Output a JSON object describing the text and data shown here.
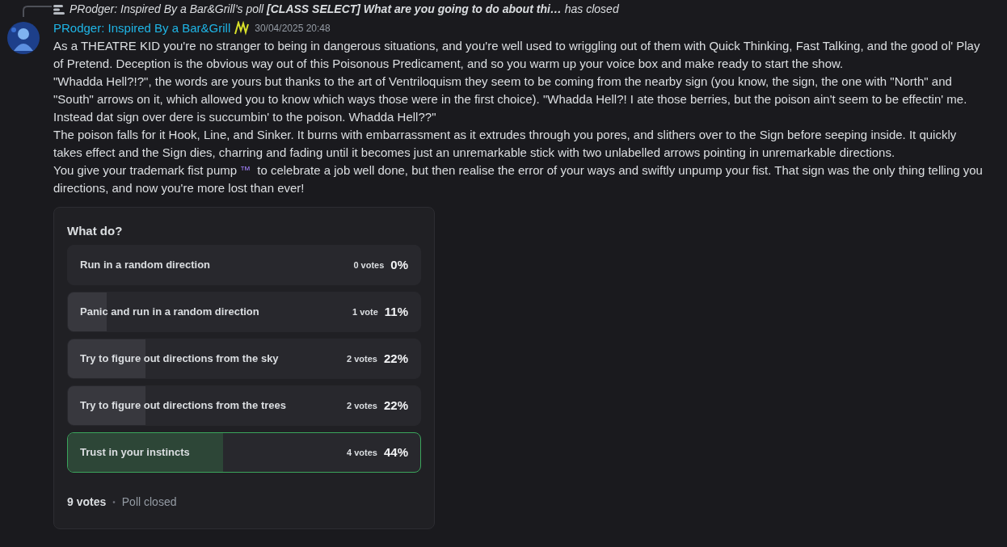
{
  "reply": {
    "text": "PRodger: Inspired By a Bar&Grill’s poll **[CLASS SELECT] What are you going to do about thi…** has closed"
  },
  "message": {
    "author": "PRodger: Inspired By a Bar&Grill",
    "timestamp": "30/04/2025 20:48",
    "paragraphs": [
      {
        "text": "As a THEATRE KID you're no stranger to being in dangerous situations, and you're well used to wriggling out of them with Quick Thinking, Fast Talking, and the good ol' Play of Pretend. Deception is the obvious way out of this Poisonous Predicament, and so you warm up your voice box and make ready to start the show."
      },
      {
        "text": "\"Whadda Hell?!?\", the words are yours but thanks to the art of Ventriloquism they seem to be coming from the nearby sign (you know, the sign, the one with \"North\" and \"South\" arrows on it, which allowed you to know which ways those were in the first choice). \"Whadda Hell?! I ate those berries, but the poison ain't seem to be effectin' me. Instead dat sign over dere is succumbin' to the poison. Whadda Hell??\""
      },
      {
        "text": "The poison falls for it Hook, Line, and Sinker. It burns with embarrassment as it extrudes through you pores, and slithers over to the Sign before seeping inside. It quickly takes effect and the Sign dies, charring and fading until it becomes just an unremarkable stick with two unlabelled arrows pointing in unremarkable directions."
      },
      {
        "text": "You give your trademark fist pump",
        "emoji": "™",
        "after": " to celebrate a job well done, but then realise the error of your ways and swiftly unpump your fist. That sign was the only thing telling you directions, and now you're more lost than ever!"
      }
    ]
  },
  "poll": {
    "question": "What do?",
    "answers": [
      {
        "label": "Run in a random direction",
        "votes": "0 votes",
        "percent": "0%",
        "level": 0,
        "selected": false
      },
      {
        "label": "Panic and run in a random direction",
        "votes": "1 vote",
        "percent": "11%",
        "level": 0.11,
        "selected": false
      },
      {
        "label": "Try to figure out directions from the sky",
        "votes": "2 votes",
        "percent": "22%",
        "level": 0.22,
        "selected": false
      },
      {
        "label": "Try to figure out directions from the trees",
        "votes": "2 votes",
        "percent": "22%",
        "level": 0.22,
        "selected": false
      },
      {
        "label": "Trust in your instincts",
        "votes": "4 votes",
        "percent": "44%",
        "level": 0.44,
        "selected": true
      }
    ],
    "total": "9 votes",
    "separator": "•",
    "status": "Poll closed"
  }
}
